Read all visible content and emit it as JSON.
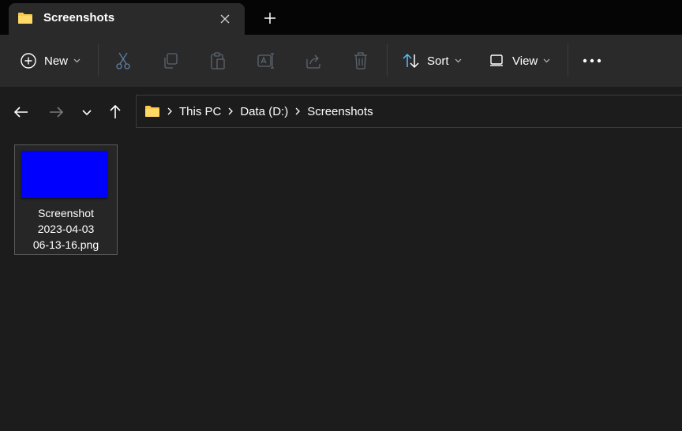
{
  "window": {
    "tab_title": "Screenshots",
    "tab_icon": "folder-icon"
  },
  "toolbar": {
    "new_label": "New",
    "sort_label": "Sort",
    "view_label": "View",
    "icons": [
      "new-icon",
      "cut-icon",
      "copy-icon",
      "paste-icon",
      "rename-icon",
      "share-icon",
      "delete-icon",
      "sort-icon",
      "view-icon",
      "more-icon"
    ]
  },
  "navigation": {
    "breadcrumb": [
      "This PC",
      "Data (D:)",
      "Screenshots"
    ]
  },
  "files": [
    {
      "name": "Screenshot\n2023-04-03\n06-13-16.png",
      "thumbnail_color": "#0000ff"
    }
  ],
  "colors": {
    "accent": "#4cc2ff",
    "folder": "#f8c94a",
    "titlebar": "#050505",
    "toolbar": "#2a2a2a",
    "background": "#1c1c1c"
  }
}
